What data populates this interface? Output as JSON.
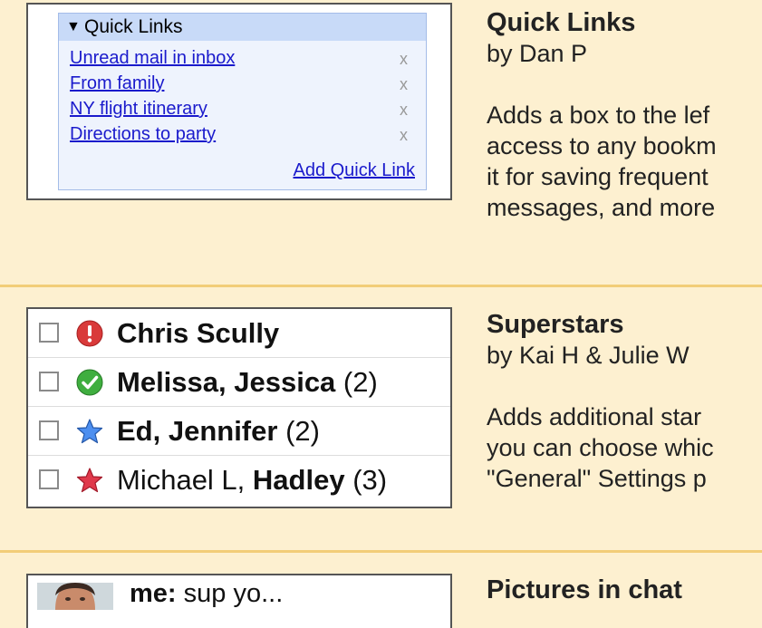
{
  "sections": {
    "quick_links": {
      "widget": {
        "header": "Quick Links",
        "links": [
          {
            "label": "Unread mail in inbox",
            "remove": "x"
          },
          {
            "label": "From family",
            "remove": "x"
          },
          {
            "label": "NY flight itinerary",
            "remove": "x"
          },
          {
            "label": "Directions to party",
            "remove": "x"
          }
        ],
        "add_label": "Add Quick Link"
      },
      "title": "Quick Links",
      "author": "by Dan P",
      "desc": [
        "Adds a box to the lef",
        "access to any bookm",
        "it for saving frequent",
        "messages, and more"
      ]
    },
    "superstars": {
      "rows": [
        {
          "icon": "red-exclamation-icon",
          "bold": "Chris Scully",
          "plain": "",
          "count": ""
        },
        {
          "icon": "green-check-icon",
          "bold": "Melissa, Jessica",
          "plain": "",
          "count": "(2)"
        },
        {
          "icon": "blue-star-icon",
          "bold": "Ed, Jennifer",
          "plain": "",
          "count": "(2)"
        },
        {
          "icon": "red-star-icon",
          "bold": "Hadley",
          "plain": "Michael L, ",
          "count": "(3)"
        }
      ],
      "title": "Superstars",
      "author": "by Kai H & Julie W",
      "desc": [
        "Adds additional star",
        "you can choose whic",
        "\"General\" Settings p"
      ]
    },
    "pictures_in_chat": {
      "chat": {
        "sender": "me:",
        "message": " sup yo..."
      },
      "title": "Pictures in chat"
    }
  },
  "colors": {
    "background": "#fdf0d0",
    "separator": "#f2cd78",
    "link": "#1a1acc",
    "widget_header": "#c8daf8"
  }
}
